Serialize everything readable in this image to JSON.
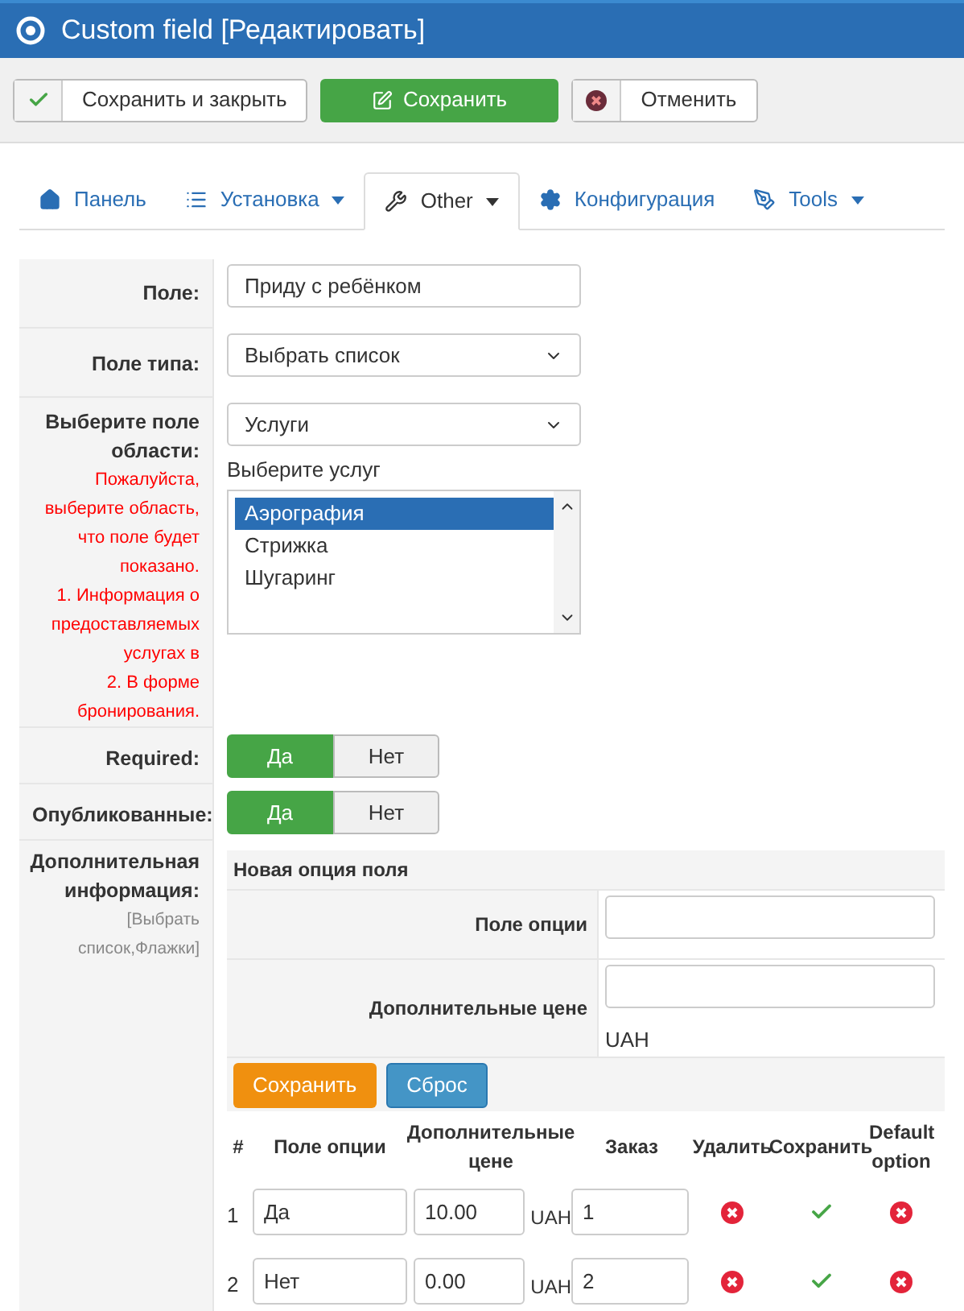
{
  "header": {
    "title": "Custom field [Редактировать]"
  },
  "toolbar": [
    {
      "kind": "check",
      "label": "Сохранить и закрыть"
    },
    {
      "kind": "primary",
      "label": "Сохранить"
    },
    {
      "kind": "cancel",
      "label": "Отменить"
    }
  ],
  "tabs": [
    {
      "kind": "home",
      "label": "Панель",
      "dropdown": false,
      "selected": false
    },
    {
      "kind": "list",
      "label": "Установка",
      "dropdown": true,
      "selected": false
    },
    {
      "kind": "wrench",
      "label": "Other",
      "dropdown": true,
      "selected": true
    },
    {
      "kind": "gear",
      "label": "Конфигурация",
      "dropdown": false,
      "selected": false
    },
    {
      "kind": "tool",
      "label": "Tools",
      "dropdown": true,
      "selected": false
    }
  ],
  "form": {
    "field": {
      "label": "Поле:",
      "value": "Приду с ребёнком"
    },
    "type": {
      "label": "Поле типа:",
      "value": "Выбрать список"
    },
    "area": {
      "label": "Выберите поле области:",
      "value": "Услуги",
      "hint": [
        "Пожалуйста, выберите область, что поле будет показано.",
        "1. Информация о предоставляемых услугах в",
        "2. В форме бронирования."
      ],
      "list_label": "Выберите услуг",
      "items": [
        {
          "label": "Аэрография",
          "selected": true
        },
        {
          "label": "Стрижка",
          "selected": false
        },
        {
          "label": "Шугаринг",
          "selected": false
        }
      ]
    },
    "toggles": [
      {
        "label": "Required:",
        "options": [
          {
            "label": "Да",
            "selected": true
          },
          {
            "label": "Нет",
            "selected": false
          }
        ]
      },
      {
        "label": "Опубликованные:",
        "options": [
          {
            "label": "Да",
            "selected": true
          },
          {
            "label": "Нет",
            "selected": false
          }
        ]
      }
    ],
    "extra": {
      "label": "Дополнительная информация:",
      "note": "[Выбрать список,Флажки]",
      "new_option": {
        "title": "Новая опция поля",
        "name_label": "Поле опции",
        "price_label": "Дополнительные цене",
        "currency": "UAH",
        "save": "Сохранить",
        "reset": "Сброс"
      },
      "columns": [
        "#",
        "Поле опции",
        "Дополнительные цене",
        "Заказ",
        "Удалить",
        "Сохранить",
        "Default option"
      ],
      "rows": [
        {
          "index": "1",
          "name": "Да",
          "price": "10.00",
          "currency": "UAH",
          "order": "1",
          "default": false
        },
        {
          "index": "2",
          "name": "Нет",
          "price": "0.00",
          "currency": "UAH",
          "order": "2",
          "default": false
        }
      ]
    }
  }
}
